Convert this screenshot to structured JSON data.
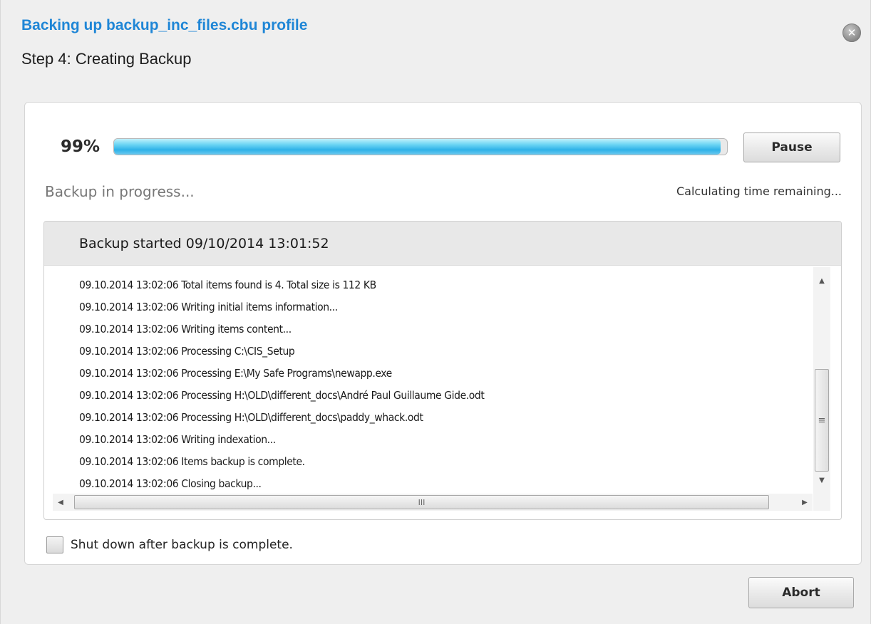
{
  "dialog": {
    "title": "Backing up backup_inc_files.cbu profile",
    "step": "Step 4: Creating Backup",
    "close_icon": "close-icon",
    "close_glyph": "✕"
  },
  "progress": {
    "percent_label": "99%",
    "fraction": 0.99,
    "pause_label": "Pause",
    "status": "Backup in progress...",
    "time_remaining": "Calculating time remaining..."
  },
  "log": {
    "header": "Backup started 09/10/2014 13:01:52",
    "lines": [
      "09.10.2014 13:02:06 Total items found is 4. Total size is 112 KB",
      "09.10.2014 13:02:06 Writing initial items information...",
      "09.10.2014 13:02:06 Writing items content...",
      "09.10.2014 13:02:06 Processing C:\\CIS_Setup",
      "09.10.2014 13:02:06 Processing E:\\My Safe Programs\\newapp.exe",
      "09.10.2014 13:02:06 Processing H:\\OLD\\different_docs\\André Paul Guillaume Gide.odt",
      "09.10.2014 13:02:06 Processing H:\\OLD\\different_docs\\paddy_whack.odt",
      "09.10.2014 13:02:06 Writing indexation...",
      "09.10.2014 13:02:06 Items backup is complete.",
      "09.10.2014 13:02:06 Closing backup..."
    ]
  },
  "options": {
    "shutdown_label": "Shut down after backup is complete.",
    "shutdown_checked": false
  },
  "footer": {
    "abort_label": "Abort"
  },
  "colors": {
    "title": "#1f86d6",
    "progress_fill": "#2fb2e8"
  }
}
